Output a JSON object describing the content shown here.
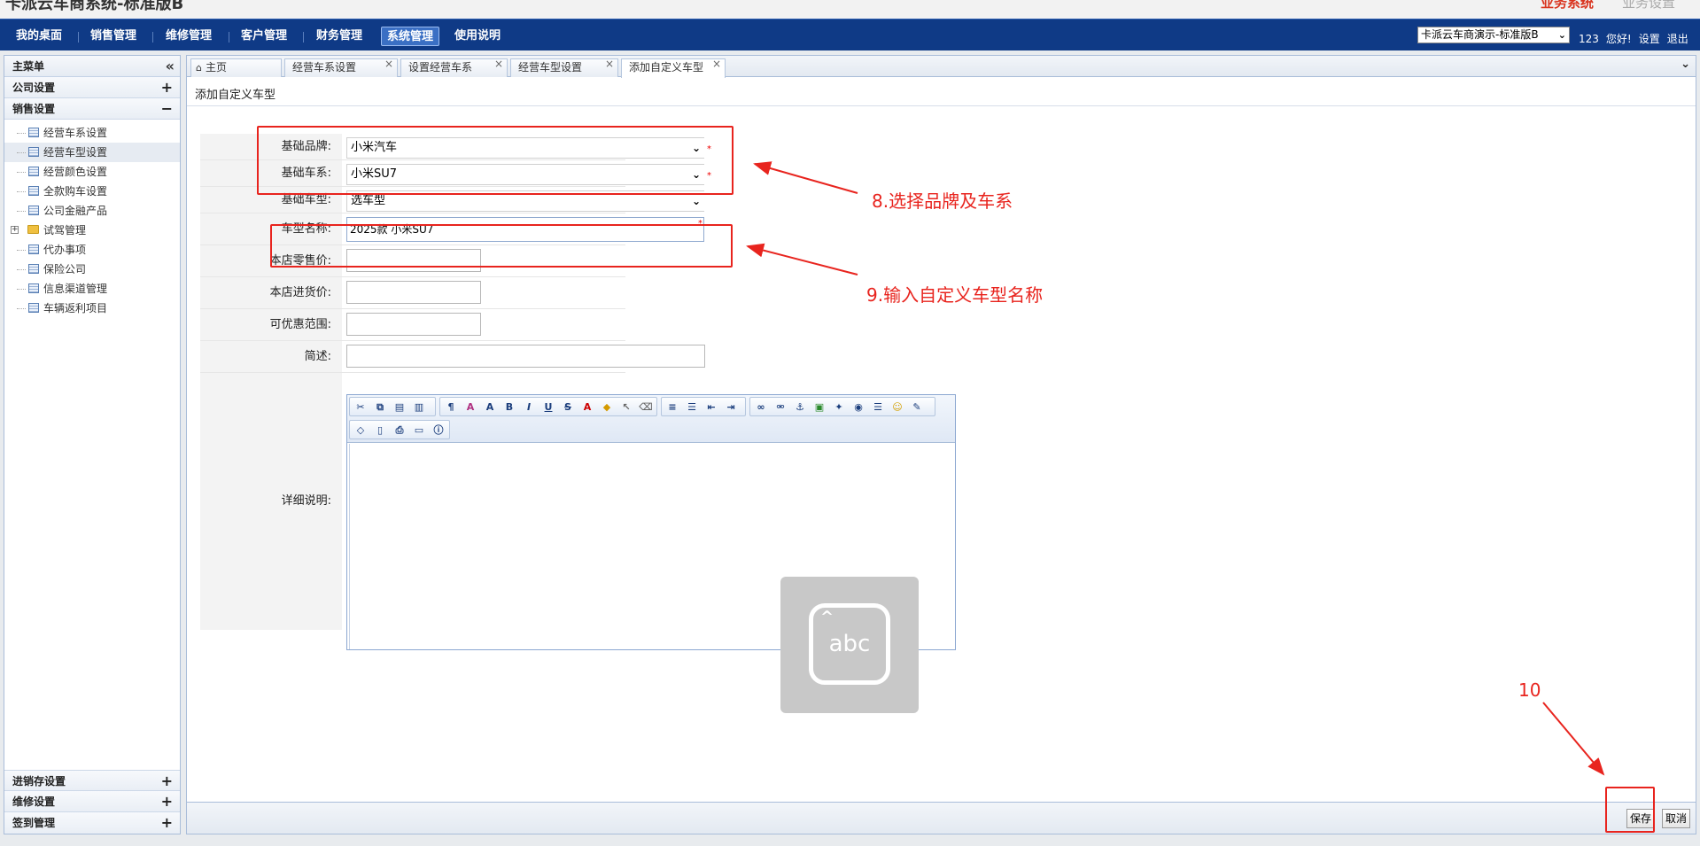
{
  "topbar": {
    "app_title": "卡派云车商系统-标准版B",
    "right_text": "业务系统",
    "right_text2": "业务设置"
  },
  "nav": {
    "items": [
      "我的桌面",
      "销售管理",
      "维修管理",
      "客户管理",
      "财务管理",
      "系统管理",
      "使用说明"
    ],
    "active_index": 5,
    "store_select": "卡派云车商演示-标准版B",
    "user": "123",
    "greeting": "您好!",
    "settings": "设置",
    "logout": "退出"
  },
  "sidebar": {
    "title": "主菜单",
    "sections_top": [
      "公司设置",
      "销售设置"
    ],
    "tree": [
      {
        "label": "经营车系设置",
        "type": "page"
      },
      {
        "label": "经营车型设置",
        "type": "page",
        "selected": true
      },
      {
        "label": "经营颜色设置",
        "type": "page"
      },
      {
        "label": "全款购车设置",
        "type": "page"
      },
      {
        "label": "公司金融产品",
        "type": "page"
      },
      {
        "label": "试驾管理",
        "type": "folder"
      },
      {
        "label": "代办事项",
        "type": "page"
      },
      {
        "label": "保险公司",
        "type": "page"
      },
      {
        "label": "信息渠道管理",
        "type": "page"
      },
      {
        "label": "车辆返利项目",
        "type": "page"
      }
    ],
    "sections_bottom": [
      "进销存设置",
      "维修设置",
      "签到管理"
    ]
  },
  "tabs": [
    "主页",
    "经营车系设置",
    "设置经营车系",
    "经营车型设置",
    "添加自定义车型"
  ],
  "page_title": "添加自定义车型",
  "form": {
    "brand_label": "基础品牌:",
    "brand_value": "小米汽车",
    "series_label": "基础车系:",
    "series_value": "小米SU7",
    "model_label": "基础车型:",
    "model_value": "选车型",
    "name_label": "车型名称:",
    "name_value": "2025款 小米SU7",
    "retail_label": "本店零售价:",
    "purchase_label": "本店进货价:",
    "discount_label": "可优惠范围:",
    "brief_label": "简述:",
    "detail_label": "详细说明:",
    "required_mark": "*"
  },
  "overlay": {
    "keyboard_text": "abc"
  },
  "footer": {
    "save": "保存",
    "cancel": "取消"
  },
  "annotations": {
    "a8": "8.选择品牌及车系",
    "a9": "9.输入自定义车型名称",
    "a10": "10"
  },
  "colors": {
    "nav_bg": "#0f3a86",
    "annotation_red": "#e8241e"
  }
}
